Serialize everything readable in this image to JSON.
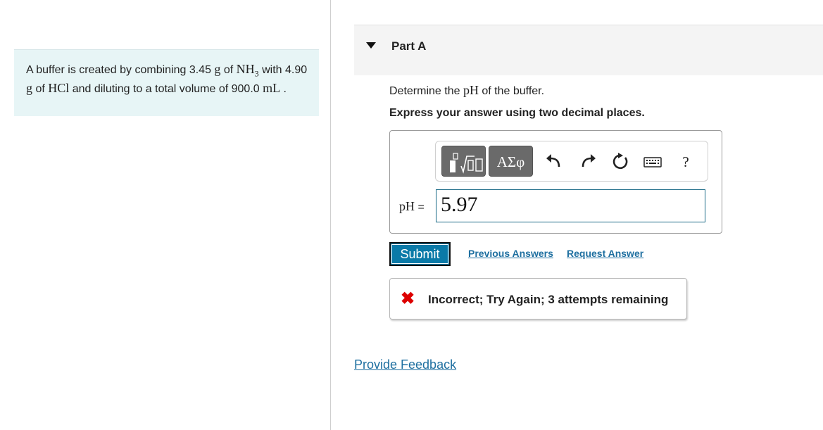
{
  "problem": {
    "segments": [
      {
        "t": "A buffer is created by combining 3.45 ",
        "math": false
      },
      {
        "t": "g",
        "math": true
      },
      {
        "t": " of ",
        "math": false
      },
      {
        "t": "NH",
        "math": true,
        "sub": "3"
      },
      {
        "t": " with 4.90 ",
        "math": false
      },
      {
        "t": "g",
        "math": true
      },
      {
        "t": " of ",
        "math": false
      },
      {
        "t": "HCl",
        "math": true
      },
      {
        "t": " and diluting to a total volume of 900.0 ",
        "math": false
      },
      {
        "t": "mL",
        "math": true
      },
      {
        "t": " .",
        "math": false
      }
    ]
  },
  "part": {
    "title": "Part A"
  },
  "question": {
    "pre": "Determine the ",
    "math": "pH",
    "post": " of the buffer."
  },
  "instruction": "Express your answer using two decimal places.",
  "toolbar": {
    "greek_label": "ΑΣφ",
    "help_label": "?"
  },
  "answer": {
    "var_label": "pH",
    "equals": "=",
    "value": "5.97"
  },
  "buttons": {
    "submit": "Submit",
    "previous_answers": "Previous Answers",
    "request_answer": "Request Answer"
  },
  "feedback": {
    "message": "Incorrect; Try Again; 3 attempts remaining",
    "icon_color": "#dd0000"
  },
  "footer": {
    "provide_feedback": "Provide Feedback"
  },
  "colors": {
    "problem_bg": "#e7f5f6",
    "submit_bg": "#0a7aa8",
    "link": "#1e6fa0"
  }
}
